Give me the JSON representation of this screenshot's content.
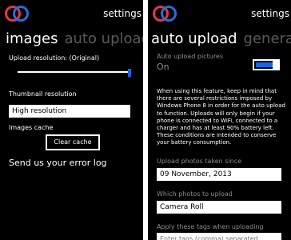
{
  "colors": {
    "accent": "#1a64dc",
    "logo_red": "#e9324e",
    "logo_blue": "#2c6ad8"
  },
  "left_screen": {
    "logo": "double-ring-logo",
    "app_title": "settings",
    "pivot": {
      "active": "images",
      "next": "auto upload",
      "clipped": "g"
    },
    "upload_resolution_label": "Upload resolution: (Original)",
    "upload_resolution_level": 1.0,
    "thumbnail_label": "Thumbnail resolution",
    "thumbnail_value": "High resolution",
    "cache_label": "Images cache",
    "clear_cache_button": "Clear cache",
    "error_log_link": "Send us your error log"
  },
  "right_screen": {
    "logo": "double-ring-logo",
    "app_title": "settings",
    "pivot": {
      "active": "auto upload",
      "next": "general",
      "clipped": "i"
    },
    "auto_upload_label": "Auto upload pictures",
    "auto_upload_state": "On",
    "auto_upload_on": true,
    "description": "When using this feature, keep in mind that there are several restrictions imposed by Windows Phone 8 in order for the auto upload to function. Uploads will only begin if your phone is connected to WiFi, connected to a charger and has at least 90% battery left. These conditions are intended to conserve your battery consumption.",
    "since_label": "Upload photos taken since",
    "since_value": "09 November, 2013",
    "which_label": "Which photos to upload",
    "which_value": "Camera Roll",
    "tags_label": "Apply these tags when uploading",
    "tags_placeholder": "Enter tags (comma) separated"
  }
}
